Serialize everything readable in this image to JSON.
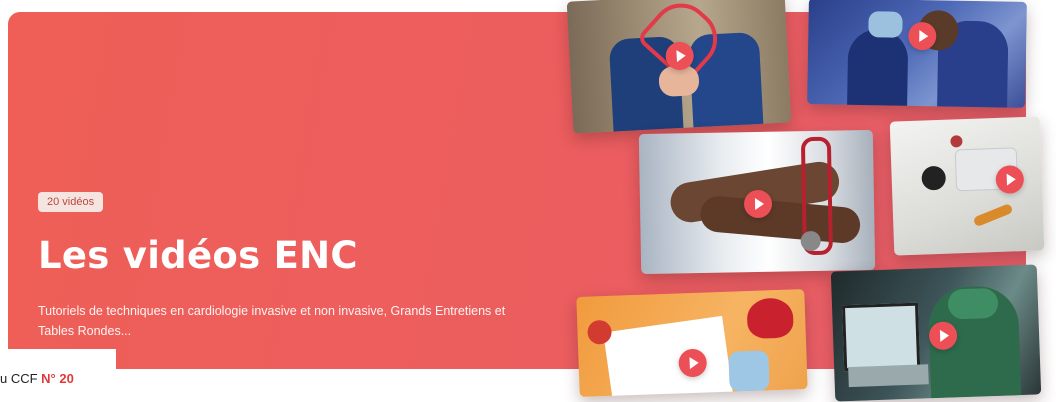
{
  "banner": {
    "badge": "20 vidéos",
    "title": "Les vidéos ENC",
    "description": "Tutoriels de techniques en cardiologie invasive et non invasive, Grands Entretiens et Tables Rondes..."
  },
  "thumbnails": [
    {
      "name": "heart-stethoscope-nurse",
      "icon": "play-icon"
    },
    {
      "name": "surgeons-operating",
      "icon": "play-icon"
    },
    {
      "name": "doctor-crossed-arms-stethoscope",
      "icon": "play-icon"
    },
    {
      "name": "stethoscope-pills-tray",
      "icon": "play-icon"
    },
    {
      "name": "ecg-heart-orange",
      "icon": "play-icon"
    },
    {
      "name": "surgeon-monitors",
      "icon": "play-icon"
    }
  ],
  "caption": {
    "prefix": "u CCF ",
    "issue": "N° 20"
  },
  "colors": {
    "banner": "#ec5d5f",
    "play": "#ec4f55",
    "accent": "#e03a3a"
  }
}
